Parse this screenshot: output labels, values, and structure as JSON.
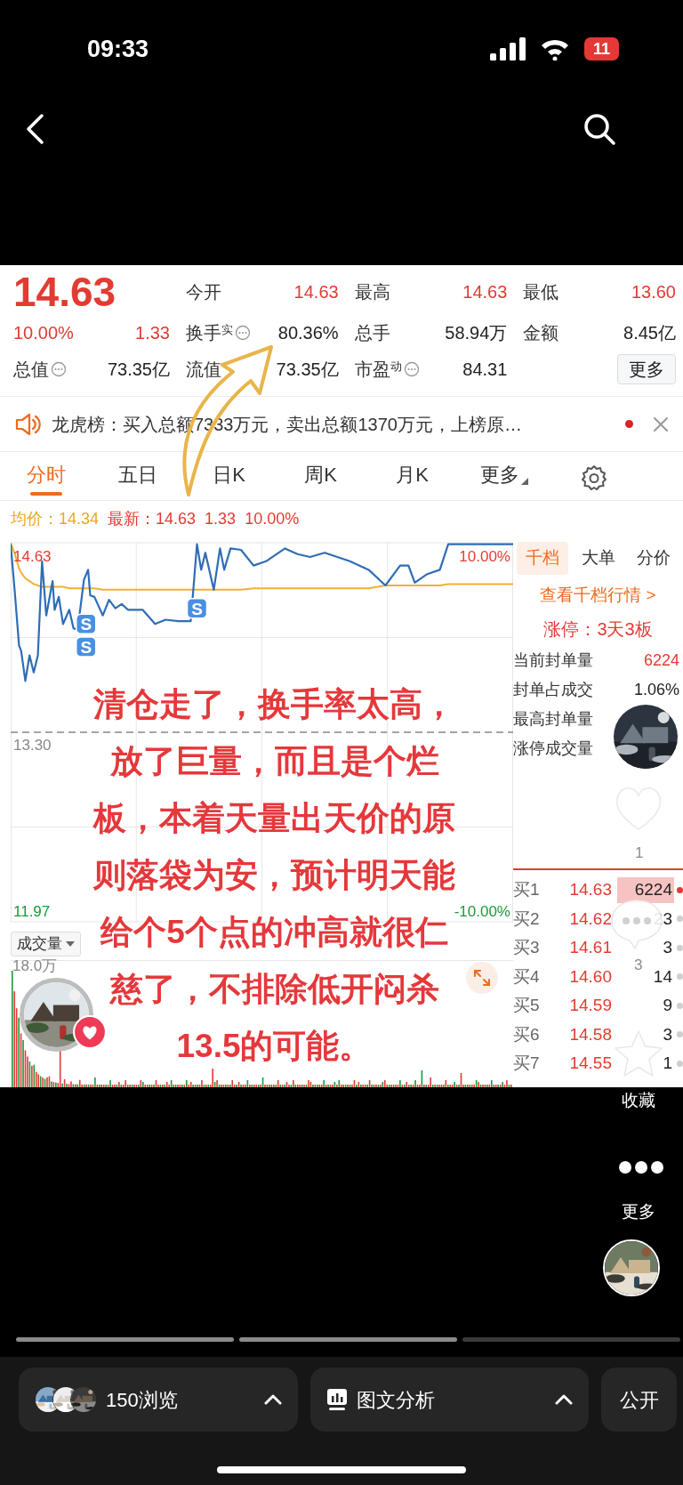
{
  "status_bar": {
    "time": "09:33",
    "battery": "11"
  },
  "quote": {
    "price": "14.63",
    "change_percent": "10.00%",
    "change": "1.33",
    "stats": [
      {
        "label": "今开",
        "value": "14.63",
        "rising": true,
        "info": false
      },
      {
        "label": "最高",
        "value": "14.63",
        "rising": true,
        "info": false
      },
      {
        "label": "最低",
        "value": "13.60",
        "rising": true,
        "info": false
      },
      {
        "label": "换手$^{实}$",
        "value": "80.36%",
        "rising": false,
        "info": true
      },
      {
        "label": "总手",
        "value": "58.94万",
        "rising": false,
        "info": false
      },
      {
        "label": "金额",
        "value": "8.45亿",
        "rising": false,
        "info": false
      },
      {
        "label": "总值",
        "value": "73.35亿",
        "rising": false,
        "info": true
      },
      {
        "label": "流值",
        "value": "73.35亿",
        "rising": false,
        "info": false
      },
      {
        "label": "市盈$^{动}$",
        "value": "84.31",
        "rising": false,
        "info": true
      }
    ],
    "more_button": "更多"
  },
  "notice": {
    "text": "龙虎榜：买入总额7333万元，卖出总额1370万元，上榜原…",
    "unread": true
  },
  "chart_tabs": [
    {
      "label": "分时",
      "selected": true,
      "dropdown": false
    },
    {
      "label": "五日",
      "selected": false,
      "dropdown": false
    },
    {
      "label": "日K",
      "selected": false,
      "dropdown": false
    },
    {
      "label": "周K",
      "selected": false,
      "dropdown": false
    },
    {
      "label": "月K",
      "selected": false,
      "dropdown": false
    },
    {
      "label": "更多",
      "selected": false,
      "dropdown": true
    }
  ],
  "legend": {
    "average": "均价：14.34",
    "latest": "最新：14.63",
    "change": "1.33",
    "change_percent": "10.00%"
  },
  "price_chart": {
    "high_label": "14.63",
    "mid_label": "13.30",
    "low_label": "11.97",
    "upper_percent": "10.00%",
    "lower_percent": "-10.00%",
    "markers": [
      "S",
      "S",
      "S"
    ]
  },
  "volume": {
    "selector": "成交量",
    "max_label": "18.0万"
  },
  "side_panel": {
    "tabs": [
      {
        "label": "千档",
        "selected": true
      },
      {
        "label": "大单",
        "selected": false
      },
      {
        "label": "分价",
        "selected": false
      }
    ],
    "link": "查看千档行情 >",
    "limit_up": "涨停：3天3板",
    "metrics": [
      {
        "label": "当前封单量",
        "value": "6224",
        "rising": true
      },
      {
        "label": "封单占成交",
        "value": "1.06%",
        "rising": false
      },
      {
        "label": "最高封单量"
      },
      {
        "label": "涨停成交量"
      }
    ],
    "bids": [
      {
        "label": "买1",
        "price": "14.63",
        "volume": "6224",
        "highlighted": true
      },
      {
        "label": "买2",
        "price": "14.62",
        "volume": "23",
        "highlighted": false
      },
      {
        "label": "买3",
        "price": "14.61",
        "volume": "3",
        "highlighted": false
      },
      {
        "label": "买4",
        "price": "14.60",
        "volume": "14",
        "highlighted": false
      },
      {
        "label": "买5",
        "price": "14.59",
        "volume": "9",
        "highlighted": false
      },
      {
        "label": "买6",
        "price": "14.58",
        "volume": "3",
        "highlighted": false
      },
      {
        "label": "买7",
        "price": "14.55",
        "volume": "1",
        "highlighted": false
      }
    ]
  },
  "caption": [
    "清仓走了，换手率太高，",
    "放了巨量，而且是个烂",
    "板，本着天量出天价的原",
    "则落袋为安，预计明天能",
    "给个5个点的冲高就很仁",
    "慈了，不排除低开闷杀",
    "13.5的可能。"
  ],
  "social": {
    "like_count": "1",
    "comment_count": "3",
    "favorite_label": "收藏",
    "more_label": "更多"
  },
  "progress": [
    {
      "filled": true
    },
    {
      "filled": true
    },
    {
      "filled": false
    }
  ],
  "bottom_bar": {
    "views": "150浏览",
    "analysis": "图文分析",
    "visibility": "公开"
  }
}
